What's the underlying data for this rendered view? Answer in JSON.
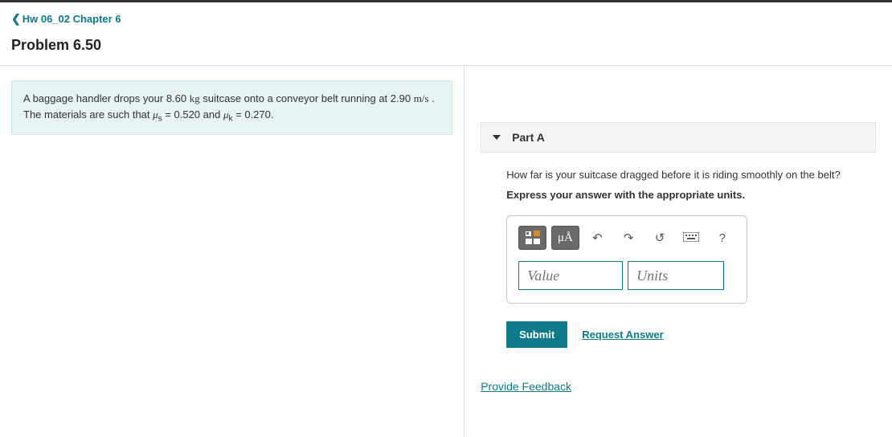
{
  "breadcrumb": {
    "label": "Hw 06_02 Chapter 6"
  },
  "problem": {
    "title": "Problem 6.50",
    "prompt_pre": "A baggage handler drops your ",
    "mass": "8.60",
    "mass_unit": "kg",
    "prompt_mid1": " suitcase onto a conveyor belt running at ",
    "speed": "2.90",
    "speed_unit": "m/s",
    "prompt_mid2": " . The materials are such that ",
    "mu_s_val": "0.520",
    "prompt_and": " and ",
    "mu_k_val": "0.270",
    "prompt_end": "."
  },
  "partA": {
    "label": "Part A",
    "question": "How far is your suitcase dragged before it is riding smoothly on the belt?",
    "instruction": "Express your answer with the appropriate units.",
    "value_placeholder": "Value",
    "units_placeholder": "Units",
    "mu_a_label": "μÅ",
    "help_label": "?"
  },
  "actions": {
    "submit": "Submit",
    "request_answer": "Request Answer",
    "provide_feedback": "Provide Feedback"
  }
}
